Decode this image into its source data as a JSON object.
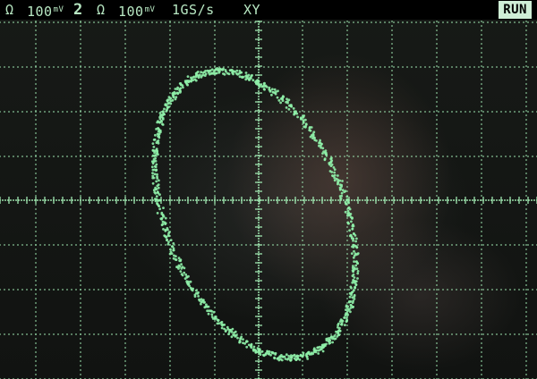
{
  "status_bar": {
    "ch1_symbol": "Ω",
    "ch1_scale_value": "100",
    "ch1_scale_unit_top": "m",
    "ch1_scale_unit_bottom": "V",
    "ch2_number": "2",
    "ch2_symbol": "Ω",
    "ch2_scale_value": "100",
    "ch2_scale_unit_top": "m",
    "ch2_scale_unit_bottom": "V",
    "sample_rate": "1GS/s",
    "mode": "XY",
    "run_state": "RUN"
  },
  "trace": {
    "color": "#8ff0a8",
    "shape": "tilted-ellipse"
  },
  "colors": {
    "graticule": "#9fe6b0",
    "status_text": "#b8e8c3",
    "status_background": "#000000"
  }
}
